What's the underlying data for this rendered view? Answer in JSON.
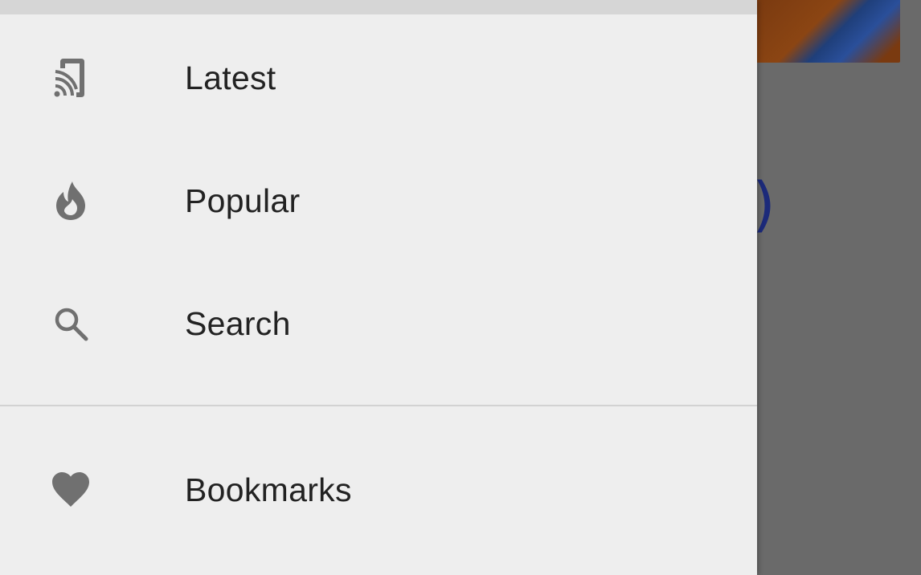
{
  "drawer": {
    "items": [
      {
        "label": "Latest",
        "icon": "cast-icon"
      },
      {
        "label": "Popular",
        "icon": "fire-icon"
      },
      {
        "label": "Search",
        "icon": "search-icon"
      }
    ],
    "secondary_items": [
      {
        "label": "Bookmarks",
        "icon": "heart-icon"
      }
    ]
  },
  "background": {
    "partial_text": ")"
  },
  "colors": {
    "drawer_bg": "#eeeeee",
    "icon": "#707070",
    "label": "#222222",
    "scrim": "#6b6b6b",
    "divider": "#d2d2d2"
  }
}
